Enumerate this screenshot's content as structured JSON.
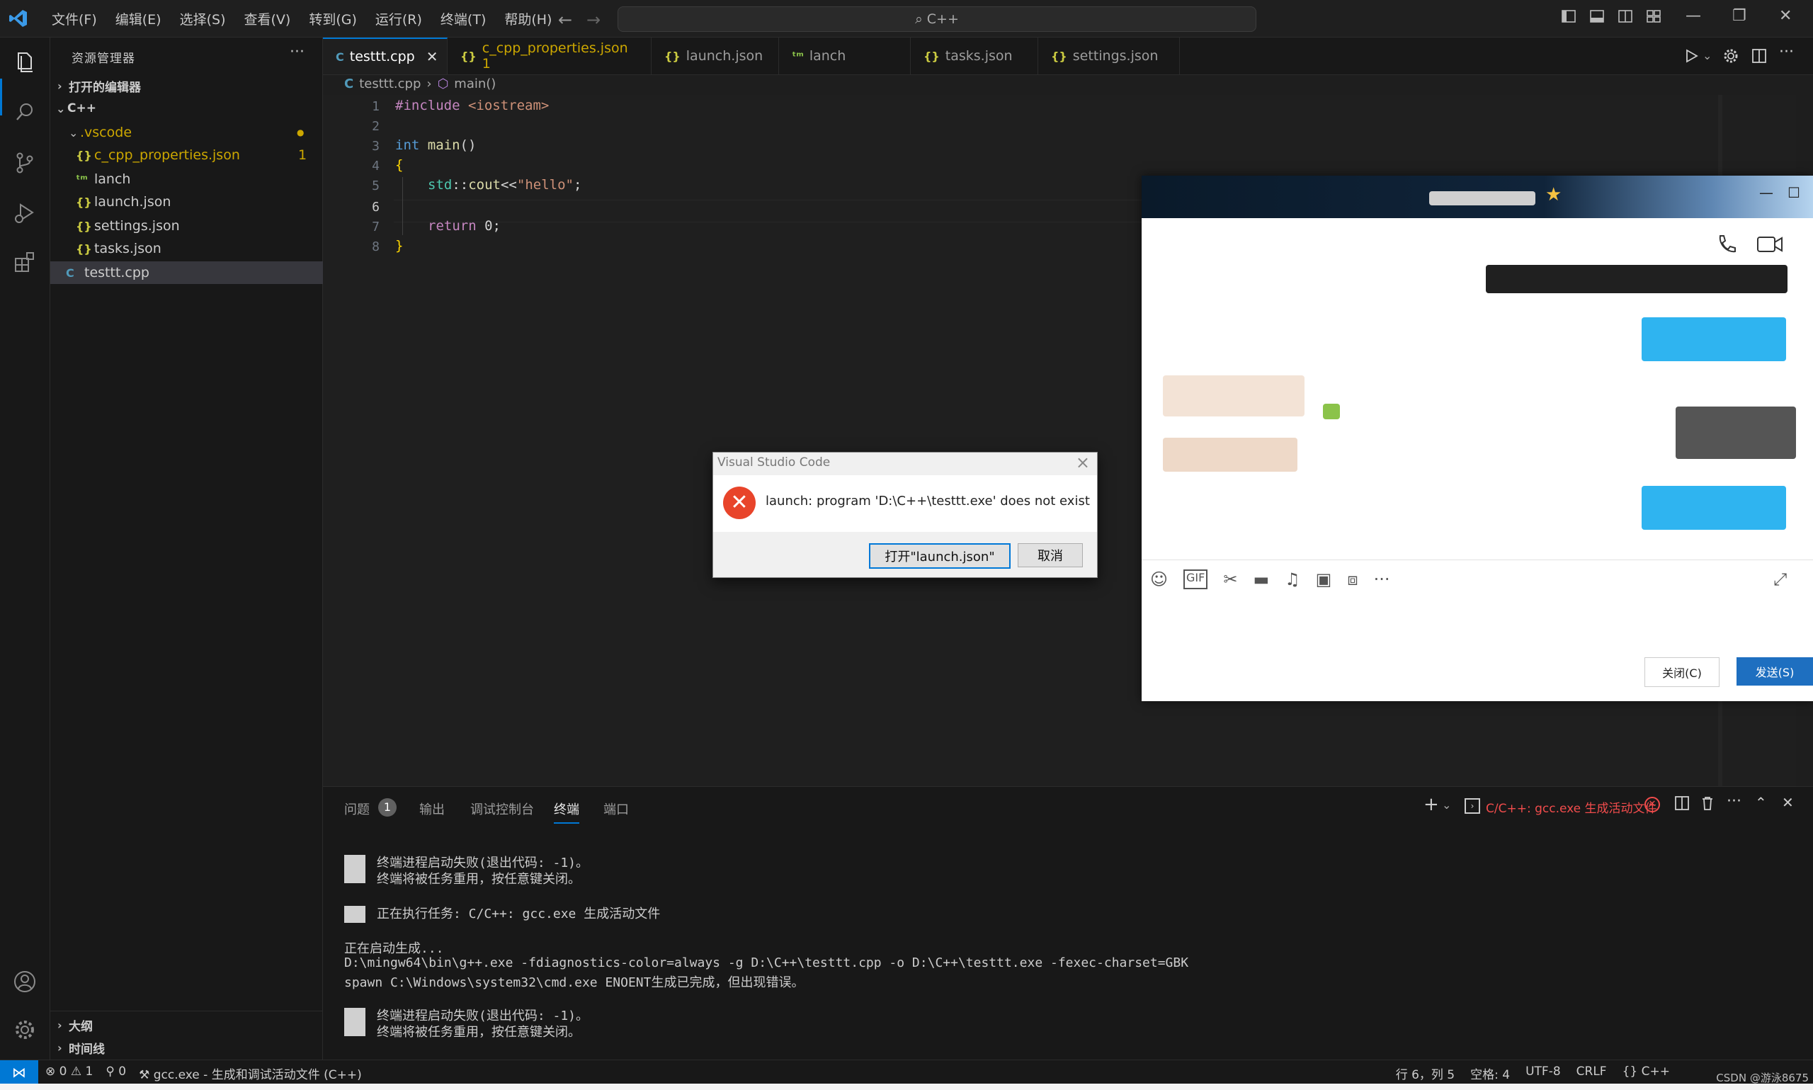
{
  "colors": {
    "accent": "#0078d4",
    "error": "#f14c4c",
    "modified": "#cca700"
  },
  "titlebar": {
    "menus": [
      "文件(F)",
      "编辑(E)",
      "选择(S)",
      "查看(V)",
      "转到(G)",
      "运行(R)",
      "终端(T)",
      "帮助(H)"
    ],
    "command_center": "C++"
  },
  "sidebar": {
    "title": "资源管理器",
    "open_editors": "打开的编辑器",
    "root": "C++",
    "vscode_folder": ".vscode",
    "files": [
      {
        "name": "c_cpp_properties.json",
        "badge": "1"
      },
      {
        "name": "lanch"
      },
      {
        "name": "launch.json"
      },
      {
        "name": "settings.json"
      },
      {
        "name": "tasks.json"
      }
    ],
    "root_file": "testtt.cpp",
    "outline": "大纲",
    "timeline": "时间线"
  },
  "tabs": [
    {
      "label": "testtt.cpp"
    },
    {
      "label": "c_cpp_properties.json 1"
    },
    {
      "label": "launch.json"
    },
    {
      "label": "lanch"
    },
    {
      "label": "tasks.json"
    },
    {
      "label": "settings.json"
    }
  ],
  "breadcrumb": {
    "file": "testtt.cpp",
    "symbol": "main()"
  },
  "editor": {
    "line_numbers": [
      "1",
      "2",
      "3",
      "4",
      "5",
      "6",
      "7",
      "8"
    ],
    "l1_pre": "#include",
    "l1_hdr": " <iostream>",
    "l3_kw": "int",
    "l3_fn": " main",
    "l3_rest": "()",
    "l4": "{",
    "l5_ns": "std",
    "l5_op": "::",
    "l5_fn": "cout",
    "l5_op2": "<<",
    "l5_str": "\"hello\"",
    "l5_end": ";",
    "l7_kw": "return",
    "l7_rest": " 0;",
    "l8": "}"
  },
  "dialog": {
    "title": "Visual Studio Code",
    "message": "launch: program 'D:\\C++\\testtt.exe' does not exist",
    "open_button": "打开\"launch.json\"",
    "cancel_button": "取消"
  },
  "chat": {
    "close_button": "关闭(C)",
    "send_button": "发送(S)"
  },
  "panel": {
    "tabs": [
      "问题",
      "输出",
      "调试控制台",
      "终端",
      "端口"
    ],
    "problems_count": "1",
    "task_label": "C/C++: gcc.exe 生成活动文件",
    "terminal": {
      "b1_l1": "终端进程启动失败(退出代码: -1)。",
      "b1_l2": "终端将被任务重用，按任意键关闭。",
      "b2": "正在执行任务: C/C++: gcc.exe 生成活动文件",
      "l3": "正在启动生成...",
      "l4": "D:\\mingw64\\bin\\g++.exe -fdiagnostics-color=always -g D:\\C++\\testtt.cpp -o D:\\C++\\testtt.exe -fexec-charset=GBK",
      "l5": "spawn C:\\Windows\\system32\\cmd.exe ENOENT生成已完成，但出现错误。",
      "b3_l1": "终端进程启动失败(退出代码: -1)。",
      "b3_l2": "终端将被任务重用，按任意键关闭。"
    }
  },
  "statusbar": {
    "errors": "0",
    "warnings": "1",
    "ports": "0",
    "task": "gcc.exe - 生成和调试活动文件 (C++)",
    "position": "行 6，列 5",
    "spaces": "空格: 4",
    "encoding": "UTF-8",
    "eol": "CRLF",
    "language": "C++",
    "watermark": "CSDN @游泳8675"
  }
}
